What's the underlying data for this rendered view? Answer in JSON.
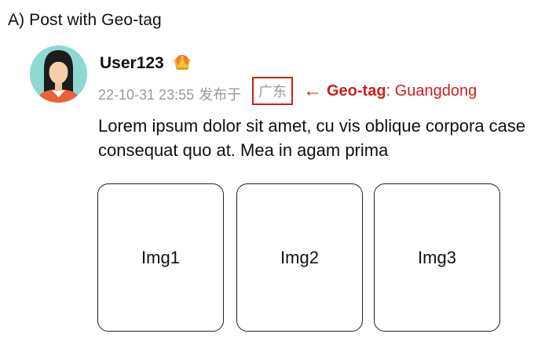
{
  "heading": "A) Post with Geo-tag",
  "post": {
    "username": "User123",
    "badge_icon": "crown-icon",
    "timestamp": "22-10-31 23:55",
    "published_from": "发布于",
    "location": "广东",
    "text": "Lorem ipsum dolor sit amet, cu vis oblique corpora case consequat quo at. Mea in agam prima",
    "images": [
      "Img1",
      "Img2",
      "Img3"
    ]
  },
  "annotation": {
    "arrow": "←",
    "label": "Geo-tag",
    "separator": ": ",
    "value": "Guangdong",
    "color": "#cc1f1f"
  },
  "colors": {
    "avatar_bg": "#8fd8d2",
    "meta_text": "#9a9a9a",
    "highlight": "#cc1f1f"
  }
}
